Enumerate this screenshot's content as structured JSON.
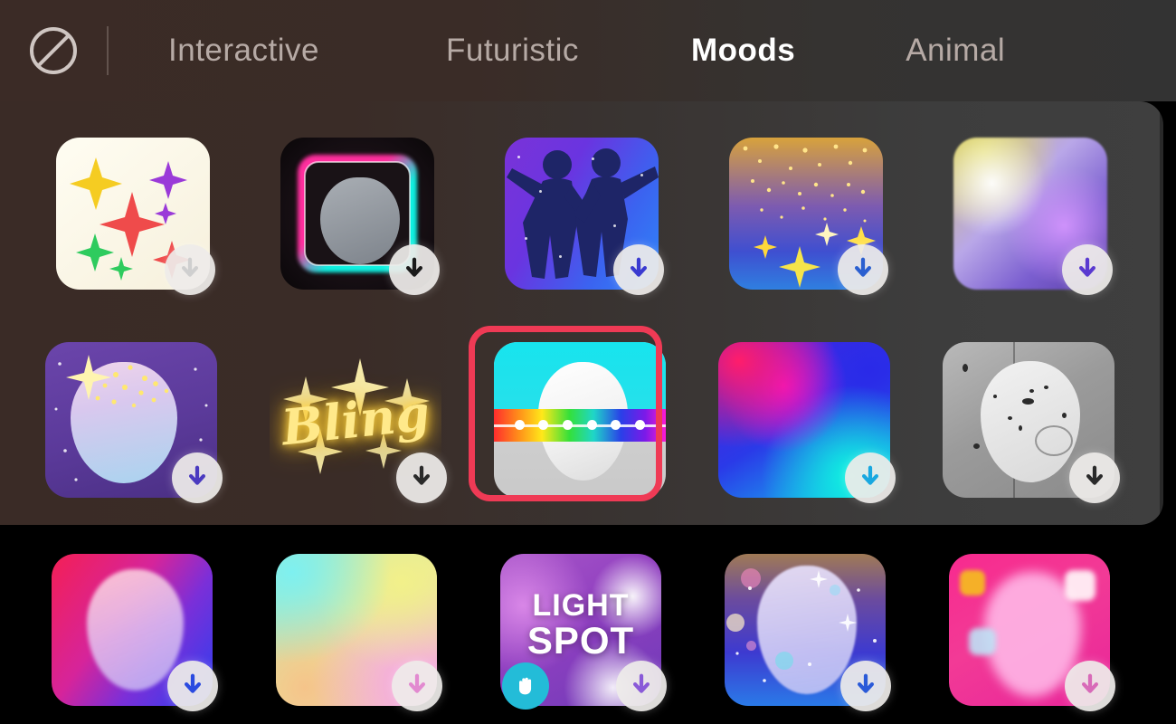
{
  "header": {
    "no_filter_icon": "no-filter-icon",
    "tabs": [
      {
        "label": "Interactive",
        "active": false
      },
      {
        "label": "Futuristic",
        "active": false
      },
      {
        "label": "Moods",
        "active": true
      },
      {
        "label": "Animal",
        "active": false
      }
    ]
  },
  "colors": {
    "panel_left": "#3a2b26",
    "panel_right": "#3d3d3d",
    "header_bg": "#3b2b26",
    "selection": "#ef3a55",
    "active_tab": "#ffffff",
    "inactive_tab": "#b6aaa5",
    "badge_bg": "#eeecea",
    "hand_badge_bg": "#23bcd8",
    "page_bg": "#000000"
  },
  "grid": {
    "rows": [
      {
        "row_name": "row-1",
        "items": [
          {
            "name": "sparkle-white-effect",
            "badge": "download",
            "badge_icon": "download-arrow-icon",
            "selected": false,
            "label": ""
          },
          {
            "name": "neon-frame-effect",
            "badge": "download",
            "badge_icon": "download-arrow-icon",
            "selected": false,
            "label": ""
          },
          {
            "name": "dancing-silhouettes-effect",
            "badge": "download",
            "badge_icon": "download-arrow-icon",
            "selected": false,
            "label": ""
          },
          {
            "name": "golden-sparkle-rain-effect",
            "badge": "download",
            "badge_icon": "download-arrow-icon",
            "selected": false,
            "label": ""
          },
          {
            "name": "bokeh-light-leak-effect",
            "badge": "download",
            "badge_icon": "download-arrow-icon",
            "selected": false,
            "label": ""
          }
        ]
      },
      {
        "row_name": "row-2",
        "items": [
          {
            "name": "purple-starry-face-effect",
            "badge": "download",
            "badge_icon": "download-arrow-icon",
            "selected": false,
            "label": ""
          },
          {
            "name": "bling-text-effect",
            "badge": "download",
            "badge_icon": "download-arrow-icon",
            "selected": false,
            "label": "Bling"
          },
          {
            "name": "rainbow-band-effect",
            "badge": "none",
            "badge_icon": "",
            "selected": true,
            "label": ""
          },
          {
            "name": "vivid-mesh-gradient-effect",
            "badge": "download",
            "badge_icon": "download-arrow-icon",
            "selected": false,
            "label": ""
          },
          {
            "name": "bw-film-grain-effect",
            "badge": "download",
            "badge_icon": "download-arrow-icon",
            "selected": false,
            "label": ""
          }
        ]
      },
      {
        "row_name": "row-3",
        "items": [
          {
            "name": "pink-blue-face-effect",
            "badge": "download",
            "badge_icon": "download-arrow-icon",
            "selected": false,
            "label": ""
          },
          {
            "name": "pastel-gradient-effect",
            "badge": "download",
            "badge_icon": "download-arrow-icon",
            "selected": false,
            "label": ""
          },
          {
            "name": "light-spot-effect",
            "badge": "download-and-hand",
            "badge_icon": "download-arrow-icon",
            "hand_icon": "hand-icon",
            "selected": false,
            "label_line1": "LIGHT",
            "label_line2": "SPOT"
          },
          {
            "name": "cosmic-bokeh-face-effect",
            "badge": "download",
            "badge_icon": "download-arrow-icon",
            "selected": false,
            "label": ""
          },
          {
            "name": "pink-bokeh-face-effect",
            "badge": "download",
            "badge_icon": "download-arrow-icon",
            "selected": false,
            "label": ""
          }
        ]
      }
    ]
  }
}
